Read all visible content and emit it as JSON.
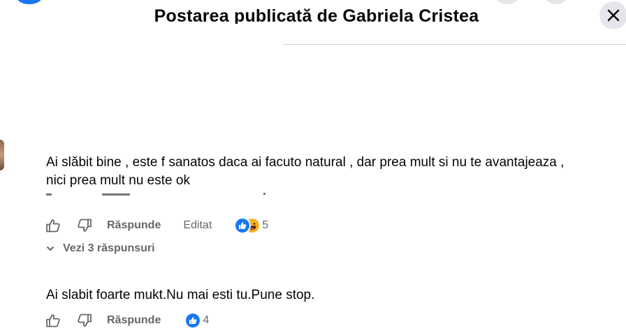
{
  "header": {
    "title": "Postarea publicată de Gabriela Cristea",
    "close_icon": "close-icon"
  },
  "comments": [
    {
      "text_line1": "Ai slăbit bine , este f sanatos daca ai facuto natural , dar prea mult si nu te avantajeaza ,",
      "text_line2": "nici prea mult nu este ok",
      "actions": {
        "reply": "Răspunde",
        "edit": "Editat"
      },
      "reactions": {
        "icons": [
          "like-icon",
          "haha-icon"
        ],
        "count": "5"
      },
      "view_replies": "Vezi 3 răspunsuri"
    },
    {
      "text": "Ai slabit foarte mukt.Nu mai esti tu.Pune stop.",
      "actions": {
        "reply": "Răspunde"
      },
      "reactions": {
        "icons": [
          "like-icon"
        ],
        "count": "4"
      }
    }
  ],
  "colors": {
    "accent": "#1877f2",
    "text": "#050505",
    "secondary": "#65676b",
    "haha": "#f7b125"
  }
}
